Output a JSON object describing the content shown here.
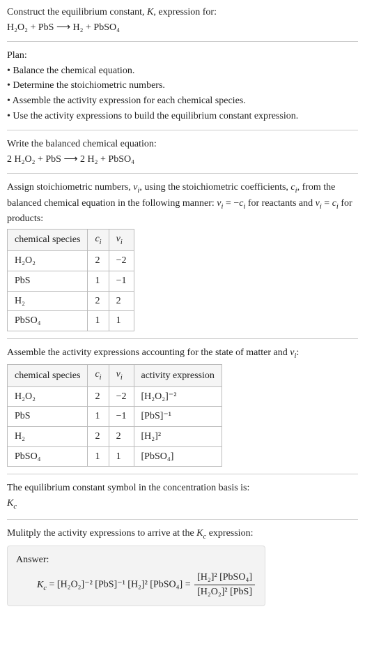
{
  "intro": {
    "line1": "Construct the equilibrium constant, K, expression for:",
    "eq": "H₂O₂ + PbS ⟶ H₂ + PbSO₄"
  },
  "plan": {
    "heading": "Plan:",
    "items": [
      "• Balance the chemical equation.",
      "• Determine the stoichiometric numbers.",
      "• Assemble the activity expression for each chemical species.",
      "• Use the activity expressions to build the equilibrium constant expression."
    ]
  },
  "balanced": {
    "heading": "Write the balanced chemical equation:",
    "eq": "2 H₂O₂ + PbS ⟶ 2 H₂ + PbSO₄"
  },
  "stoich_intro": "Assign stoichiometric numbers, νᵢ, using the stoichiometric coefficients, cᵢ, from the balanced chemical equation in the following manner: νᵢ = −cᵢ for reactants and νᵢ = cᵢ for products:",
  "table1": {
    "headers": [
      "chemical species",
      "cᵢ",
      "νᵢ"
    ],
    "rows": [
      [
        "H₂O₂",
        "2",
        "−2"
      ],
      [
        "PbS",
        "1",
        "−1"
      ],
      [
        "H₂",
        "2",
        "2"
      ],
      [
        "PbSO₄",
        "1",
        "1"
      ]
    ]
  },
  "activity_intro": "Assemble the activity expressions accounting for the state of matter and νᵢ:",
  "table2": {
    "headers": [
      "chemical species",
      "cᵢ",
      "νᵢ",
      "activity expression"
    ],
    "rows": [
      [
        "H₂O₂",
        "2",
        "−2",
        "[H₂O₂]⁻²"
      ],
      [
        "PbS",
        "1",
        "−1",
        "[PbS]⁻¹"
      ],
      [
        "H₂",
        "2",
        "2",
        "[H₂]²"
      ],
      [
        "PbSO₄",
        "1",
        "1",
        "[PbSO₄]"
      ]
    ]
  },
  "kc_symbol": {
    "line": "The equilibrium constant symbol in the concentration basis is:",
    "symbol": "K_c"
  },
  "multiply": "Mulitply the activity expressions to arrive at the K_c expression:",
  "answer": {
    "label": "Answer:",
    "lhs": "K_c = [H₂O₂]⁻² [PbS]⁻¹ [H₂]² [PbSO₄] =",
    "num": "[H₂]² [PbSO₄]",
    "den": "[H₂O₂]² [PbS]"
  }
}
